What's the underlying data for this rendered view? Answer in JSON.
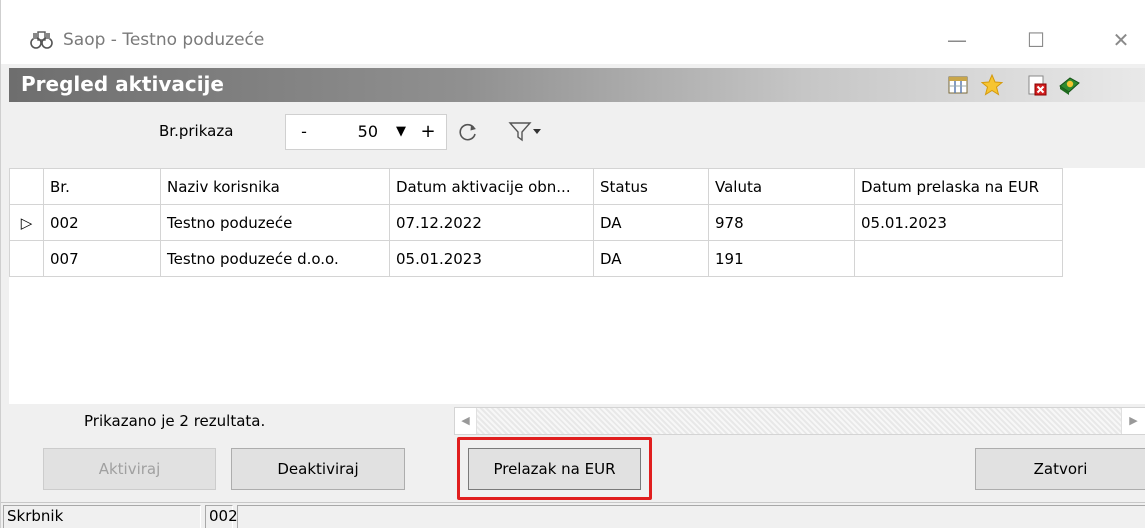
{
  "window": {
    "title": "Saop  - Testno poduzeće",
    "minimize_label": "—",
    "maximize_label": "☐",
    "close_label": "✕"
  },
  "header": {
    "title": "Pregled aktivacije",
    "icons": [
      "columns-icon",
      "star-icon",
      "close-document-icon",
      "help-book-icon"
    ]
  },
  "toolbar": {
    "count_label": "Br.prikaza",
    "minus_label": "-",
    "count_value": "50",
    "dropdown_glyph": "▼",
    "plus_label": "+"
  },
  "grid": {
    "columns": [
      "Br.",
      "Naziv korisnika",
      "Datum aktivacije obn...",
      "Status",
      "Valuta",
      "Datum prelaska na EUR"
    ],
    "rows": [
      {
        "indicator": "▷",
        "br": "002",
        "naziv": "Testno poduzeće",
        "datum": "07.12.2022",
        "status": "DA",
        "valuta": "978",
        "eur": "05.01.2023"
      },
      {
        "indicator": "",
        "br": "007",
        "naziv": "Testno poduzeće d.o.o.",
        "datum": "05.01.2023",
        "status": "DA",
        "valuta": "191",
        "eur": ""
      }
    ]
  },
  "footer": {
    "results_text": "Prikazano je 2 rezultata.",
    "scroll_left_glyph": "◀",
    "scroll_right_glyph": "▶"
  },
  "buttons": {
    "aktiviraj": "Aktiviraj",
    "deaktiviraj": "Deaktiviraj",
    "prelazak": "Prelazak na EUR",
    "zatvori": "Zatvori"
  },
  "statusbar": {
    "user": "Skrbnik",
    "code": "002",
    "extra": ""
  },
  "colors": {
    "highlight": "#e01e1e",
    "header_start": "#6e6e6e"
  }
}
